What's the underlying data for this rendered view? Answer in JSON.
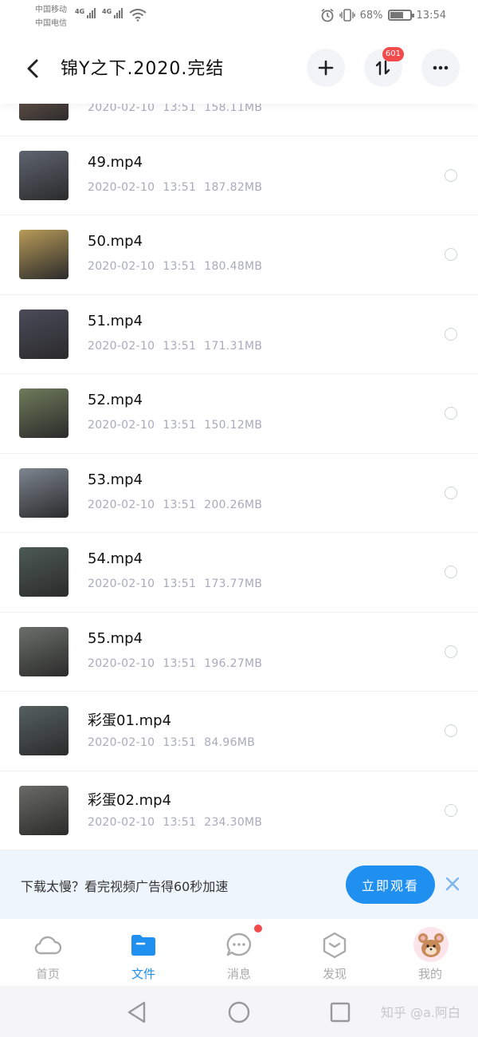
{
  "status_bar": {
    "carrier1": "中国移动",
    "carrier2": "中国电信",
    "net1": "4G",
    "net2": "4G",
    "battery_percent": "68%",
    "battery_level": 0.68,
    "time": "13:54"
  },
  "header": {
    "title": "锦Y之下.2020.完结",
    "badge_count": "601"
  },
  "files": [
    {
      "name": "",
      "date": "2020-02-10",
      "time": "13:51",
      "size": "158.11MB",
      "thumb": "#8a6a5e"
    },
    {
      "name": "49.mp4",
      "date": "2020-02-10",
      "time": "13:51",
      "size": "187.82MB",
      "thumb": "#5e6470"
    },
    {
      "name": "50.mp4",
      "date": "2020-02-10",
      "time": "13:51",
      "size": "180.48MB",
      "thumb": "#b79a58"
    },
    {
      "name": "51.mp4",
      "date": "2020-02-10",
      "time": "13:51",
      "size": "171.31MB",
      "thumb": "#4a4a5a"
    },
    {
      "name": "52.mp4",
      "date": "2020-02-10",
      "time": "13:51",
      "size": "150.12MB",
      "thumb": "#6e7b5a"
    },
    {
      "name": "53.mp4",
      "date": "2020-02-10",
      "time": "13:51",
      "size": "200.26MB",
      "thumb": "#7d8590"
    },
    {
      "name": "54.mp4",
      "date": "2020-02-10",
      "time": "13:51",
      "size": "173.77MB",
      "thumb": "#4d5a55"
    },
    {
      "name": "55.mp4",
      "date": "2020-02-10",
      "time": "13:51",
      "size": "196.27MB",
      "thumb": "#6b6f6a"
    },
    {
      "name": "彩蛋01.mp4",
      "date": "2020-02-10",
      "time": "13:51",
      "size": "84.96MB",
      "thumb": "#556060"
    },
    {
      "name": "彩蛋02.mp4",
      "date": "2020-02-10",
      "time": "13:51",
      "size": "234.30MB",
      "thumb": "#6a6a66"
    }
  ],
  "promo": {
    "text": "下载太慢？看完视频广告得60秒加速",
    "button": "立即观看"
  },
  "tabs": [
    {
      "label": "首页",
      "icon": "cloud-icon"
    },
    {
      "label": "文件",
      "icon": "folder-icon"
    },
    {
      "label": "消息",
      "icon": "chat-icon"
    },
    {
      "label": "发现",
      "icon": "discover-icon"
    },
    {
      "label": "我的",
      "icon": "avatar"
    }
  ],
  "watermark": "知乎 @a.阿白",
  "colors": {
    "accent": "#1f8ff0",
    "badge": "#f24b4b",
    "promo_bg": "#eef5fc"
  }
}
